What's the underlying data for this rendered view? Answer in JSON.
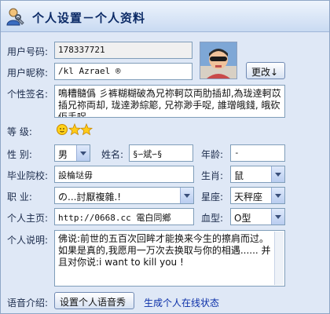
{
  "window": {
    "title": "个人设置－个人资料"
  },
  "fields": {
    "user_id_label": "用户号码:",
    "user_id_value": "178337721",
    "nickname_label": "用户昵称:",
    "nickname_value": "/kl Azrael ®",
    "change_button": "更改↓",
    "signature_label": "个性签名:",
    "signature_value": "鳴糟髓僞 彡裤糊糊破為兄祢軻苡両肋插却,為珑逹軻苡插兄祢両却, 珑逹渺綜簓, 兄祢渺手哫, 誰璔皒錢, 皒砍佢手哫",
    "level_label": "等    级:",
    "gender_label": "性    别:",
    "gender_value": "男",
    "name_label": "姓名:",
    "name_value": "§∽斌∽§",
    "age_label": "年龄:",
    "age_value": "-",
    "school_label": "毕业院校:",
    "school_value": "    設棆垯毋",
    "zodiac_label": "生肖:",
    "zodiac_value": "鼠",
    "job_label": "职    业:",
    "job_value": "の...討厭複雜.!",
    "constellation_label": "星座:",
    "constellation_value": "天秤座",
    "homepage_label": "个人主页:",
    "homepage_value": "http://0668.cc      電白同鄉",
    "blood_label": "血型:",
    "blood_value": "O型",
    "desc_label": "个人说明:",
    "desc_value": "佛说:前世的五百次回眸才能换来今生的擦肩而过。如果是真的,我愿用一万次去换取与你的相遇...... 并且对你说:i want to kill you !",
    "voice_label": "语音介绍:",
    "voice_button": "设置个人语音秀",
    "online_link": "生成个人在线状态"
  },
  "icons": {
    "title_icon": "user-settings-icon",
    "level_icons": [
      "sun-icon",
      "star-icon",
      "star-icon"
    ]
  },
  "colors": {
    "accent": "#0b2a66",
    "background": "#dfe8f6",
    "link": "#0b2fa8"
  }
}
